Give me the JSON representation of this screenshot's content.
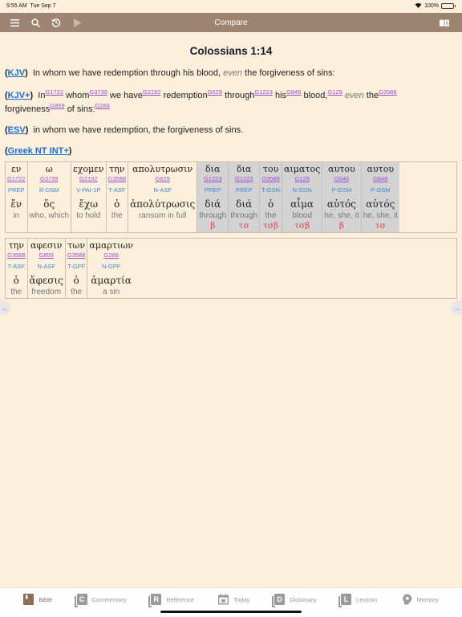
{
  "status": {
    "time": "9:55 AM",
    "date": "Tue Sep 7",
    "battery": "100%"
  },
  "navbar": {
    "title": "Compare",
    "icons": [
      "menu-icon",
      "search-icon",
      "history-icon",
      "play-icon",
      "book-icon"
    ]
  },
  "passage": {
    "reference": "Colossians 1:14"
  },
  "verses": {
    "kjv": {
      "label": "KJV",
      "text_before": "In whom we have redemption through his blood, ",
      "italic": "even",
      "text_after": " the forgiveness of sins:"
    },
    "kjvplus": {
      "label": "KJV+",
      "words": [
        {
          "w": "In",
          "s": "G1722"
        },
        {
          "w": "whom",
          "s": "G3739"
        },
        {
          "w": "we have",
          "s": "G2192"
        },
        {
          "w": "redemption",
          "s": "G629"
        },
        {
          "w": "through",
          "s": "G1223"
        },
        {
          "w": "his",
          "s": "G846"
        },
        {
          "w": "blood,",
          "s": "G129"
        },
        {
          "w": "even",
          "s": "",
          "italic": true
        },
        {
          "w": "the",
          "s": "G3588"
        },
        {
          "w": "forgiveness",
          "s": "G859"
        },
        {
          "w": "of sins:",
          "s": "G266"
        }
      ]
    },
    "esv": {
      "label": "ESV",
      "text": "in whom we have redemption, the forgiveness of sins."
    },
    "greek": {
      "label": "Greek NT INT+"
    }
  },
  "interlinear": {
    "rows": [
      [
        {
          "greek": "εν",
          "strong": "G1722",
          "morph": "PREP",
          "lemma": "ἔν",
          "gloss": "in",
          "mark": "",
          "hl": false
        },
        {
          "greek": "ω",
          "strong": "G3739",
          "morph": "R-DSM",
          "lemma": "ὅς",
          "gloss": "who, which",
          "mark": "",
          "hl": false
        },
        {
          "greek": "εχομεν",
          "strong": "G2192",
          "morph": "V-PAI-1P",
          "lemma": "ἔχω",
          "gloss": "to hold",
          "mark": "",
          "hl": false
        },
        {
          "greek": "την",
          "strong": "G3588",
          "morph": "T-ASF",
          "lemma": "ὁ",
          "gloss": "the",
          "mark": "",
          "hl": false
        },
        {
          "greek": "απολυτρωσιν",
          "strong": "G629",
          "morph": "N-ASF",
          "lemma": "ἀπολύτρωσις",
          "gloss": "ransom in full",
          "mark": "",
          "hl": false
        },
        {
          "greek": "δια",
          "strong": "G1223",
          "morph": "PREP",
          "lemma": "διά",
          "gloss": "through",
          "mark": "β",
          "hl": true
        },
        {
          "greek": "δια",
          "strong": "G1223",
          "morph": "PREP",
          "lemma": "διά",
          "gloss": "through",
          "mark": "τσ",
          "hl": true
        },
        {
          "greek": "του",
          "strong": "G3588",
          "morph": "T-GSN",
          "lemma": "ὁ",
          "gloss": "the",
          "mark": "τσβ",
          "hl": true
        },
        {
          "greek": "αιματος",
          "strong": "G129",
          "morph": "N-GSN",
          "lemma": "αἷμα",
          "gloss": "blood",
          "mark": "τσβ",
          "hl": true
        },
        {
          "greek": "αυτου",
          "strong": "G846",
          "morph": "P-GSM",
          "lemma": "αὐτός",
          "gloss": "he, she, it",
          "mark": "β",
          "hl": true
        },
        {
          "greek": "αυτου",
          "strong": "G846",
          "morph": "P-GSM",
          "lemma": "αὐτός",
          "gloss": "he, she, it",
          "mark": "τσ",
          "hl": true
        }
      ],
      [
        {
          "greek": "την",
          "strong": "G3588",
          "morph": "T-ASF",
          "lemma": "ὁ",
          "gloss": "the",
          "mark": "",
          "hl": false
        },
        {
          "greek": "αφεσιν",
          "strong": "G859",
          "morph": "N-ASF",
          "lemma": "ἄφεσις",
          "gloss": "freedom",
          "mark": "",
          "hl": false
        },
        {
          "greek": "των",
          "strong": "G3588",
          "morph": "T-GPF",
          "lemma": "ὁ",
          "gloss": "the",
          "mark": "",
          "hl": false
        },
        {
          "greek": "αμαρτιων",
          "strong": "G266",
          "morph": "N-GPF",
          "lemma": "ἁμαρτία",
          "gloss": "a sin",
          "mark": "",
          "hl": false
        }
      ]
    ]
  },
  "tabbar": {
    "tabs": [
      {
        "label": "Bible",
        "icon": "bible-icon",
        "glyph": "",
        "active": true
      },
      {
        "label": "Commentary",
        "icon": "commentary-icon",
        "glyph": "C",
        "active": false
      },
      {
        "label": "Reference",
        "icon": "reference-icon",
        "glyph": "R",
        "active": false
      },
      {
        "label": "Today",
        "icon": "calendar-icon",
        "glyph": "",
        "active": false
      },
      {
        "label": "Dictionary",
        "icon": "dictionary-icon",
        "glyph": "D",
        "active": false
      },
      {
        "label": "Lexicon",
        "icon": "lexicon-icon",
        "glyph": "L",
        "active": false
      },
      {
        "label": "Memory",
        "icon": "memory-icon",
        "glyph": "",
        "active": false
      }
    ]
  },
  "colors": {
    "background": "#fcf0dc",
    "navbar": "#9e8472",
    "link": "#1a6ed8",
    "strong": "#9b4ed1",
    "morph": "#3a87d6",
    "mark": "#e03c3c",
    "highlight": "#d3d3d3"
  }
}
